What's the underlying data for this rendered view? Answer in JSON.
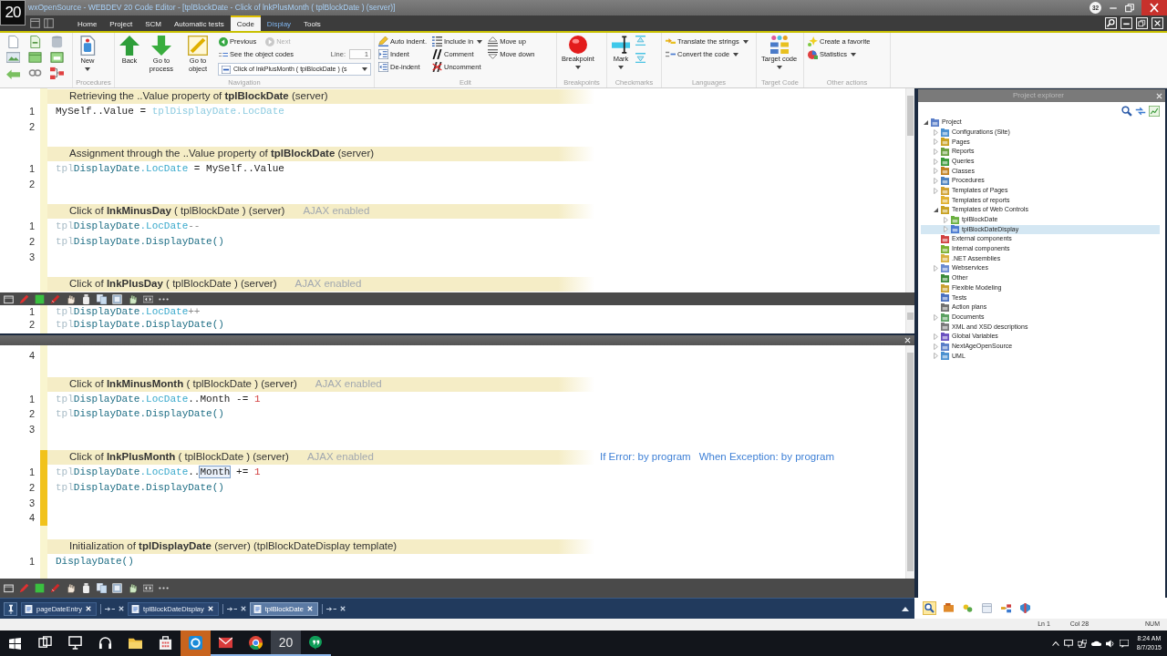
{
  "title_bar": {
    "logo": "20",
    "title": "wxOpenSource - WEBDEV 20  Code Editor - [tplBlockDate - Click of lnkPlusMonth ( tplBlockDate ) (server)]",
    "badge": "32"
  },
  "menu_tabs": [
    {
      "label": "Home",
      "selected": false,
      "kind": "standard"
    },
    {
      "label": "Project",
      "selected": false,
      "kind": "standard"
    },
    {
      "label": "SCM",
      "selected": false,
      "kind": "standard"
    },
    {
      "label": "Automatic tests",
      "selected": false,
      "kind": "standard"
    },
    {
      "label": "Code",
      "selected": true,
      "kind": "standard"
    },
    {
      "label": "Display",
      "selected": false,
      "kind": "contextual"
    },
    {
      "label": "Tools",
      "selected": false,
      "kind": "standard"
    }
  ],
  "ribbon": {
    "procedures": {
      "label": "Procedures",
      "new_button": "New"
    },
    "navigation": {
      "label": "Navigation",
      "back": "Back",
      "go_to_process": "Go to process",
      "go_to_object": "Go to object",
      "previous": {
        "label": "Previous",
        "disabled": false
      },
      "next": {
        "label": "Next",
        "disabled": true
      },
      "object_codes": "See the object codes",
      "line_label": "Line:",
      "line_value": "1",
      "event": "Click of lnkPlusMonth ( tplBlockDate ) (s"
    },
    "edit": {
      "label": "Edit",
      "columns": [
        [
          {
            "label": "Auto indent.",
            "kind": "auto-indent",
            "dropdown": false
          },
          {
            "label": "Indent",
            "kind": "indent",
            "dropdown": false
          },
          {
            "label": "De-indent",
            "kind": "de-indent",
            "dropdown": false
          }
        ],
        [
          {
            "label": "Include in",
            "kind": "include",
            "dropdown": true
          },
          {
            "label": "Comment",
            "kind": "comment",
            "dropdown": false
          },
          {
            "label": "Uncomment",
            "kind": "uncomment",
            "dropdown": false
          }
        ],
        [
          {
            "label": "Move up",
            "kind": "move-up",
            "dropdown": false
          },
          {
            "label": "Move down",
            "kind": "move-down",
            "dropdown": false
          }
        ]
      ]
    },
    "breakpoints": {
      "label": "Breakpoints",
      "button": "Breakpoint"
    },
    "checkmarks": {
      "label": "Checkmarks",
      "button": "Mark"
    },
    "languages": {
      "label": "Languages",
      "items": [
        {
          "label": "Translate the strings",
          "kind": "translate",
          "dropdown": true
        },
        {
          "label": "Convert the code",
          "kind": "convert",
          "dropdown": true
        }
      ]
    },
    "target_code": {
      "label": "Target Code",
      "button": "Target code"
    },
    "other_actions": {
      "label": "Other actions",
      "items": [
        {
          "label": "Create a favorite",
          "kind": "favorite",
          "dropdown": false
        },
        {
          "label": "Statistics",
          "kind": "statistics",
          "dropdown": true
        }
      ]
    }
  },
  "editor": {
    "upper_pane": {
      "blocks": [
        {
          "title": "Retrieving the ..Value property of **tplBlockDate** (server)",
          "current": false,
          "lines": [
            {
              "number": "1",
              "code": [
                {
                  "text": "MySelf..Value = ",
                  "kind": "plain"
                },
                {
                  "text": "tplDisplayDate.LocDate",
                  "kind": "faded"
                }
              ]
            },
            {
              "number": "2"
            }
          ]
        },
        {
          "title": "Assignment through the ..Value property of **tplBlockDate** (server)",
          "current": false,
          "lines": [
            {
              "number": "1",
              "code": [
                {
                  "text": "tpl",
                  "kind": "prefix"
                },
                {
                  "text": "DisplayDate",
                  "kind": "object"
                },
                {
                  "text": ".LocDate",
                  "kind": "property"
                },
                {
                  "text": " = MySelf..Value",
                  "kind": "plain"
                }
              ]
            },
            {
              "number": "2"
            }
          ]
        },
        {
          "title": "Click of **lnkMinusDay** ( tplBlockDate ) (server)",
          "ajax": "AJAX enabled",
          "current": false,
          "lines": [
            {
              "number": "1",
              "code": [
                {
                  "text": "tpl",
                  "kind": "prefix"
                },
                {
                  "text": "DisplayDate",
                  "kind": "object"
                },
                {
                  "text": ".LocDate",
                  "kind": "property"
                },
                {
                  "text": "--",
                  "kind": "operator"
                }
              ]
            },
            {
              "number": "2",
              "code": [
                {
                  "text": "tpl",
                  "kind": "prefix"
                },
                {
                  "text": "DisplayDate.DisplayDate()",
                  "kind": "object"
                }
              ]
            },
            {
              "number": "3"
            }
          ]
        },
        {
          "title": "Click of **lnkPlusDay** ( tplBlockDate ) (server)",
          "ajax": "AJAX enabled",
          "current": false
        }
      ]
    },
    "split_pane": {
      "lines": [
        {
          "number": "1",
          "code": [
            {
              "text": "tpl",
              "kind": "prefix"
            },
            {
              "text": "DisplayDate",
              "kind": "object"
            },
            {
              "text": ".LocDate",
              "kind": "property"
            },
            {
              "text": "++",
              "kind": "operator"
            }
          ]
        },
        {
          "number": "2",
          "code": [
            {
              "text": "tpl",
              "kind": "prefix"
            },
            {
              "text": "DisplayDate.DisplayDate()",
              "kind": "object"
            }
          ]
        }
      ]
    },
    "lower_pane": {
      "lines": [
        {
          "number": "4"
        }
      ],
      "blocks": [
        {
          "title": "Click of **lnkMinusMonth** ( tplBlockDate ) (server)",
          "ajax": "AJAX enabled",
          "current": false,
          "lines": [
            {
              "number": "1",
              "code": [
                {
                  "text": "tpl",
                  "kind": "prefix"
                },
                {
                  "text": "DisplayDate",
                  "kind": "object"
                },
                {
                  "text": ".LocDate",
                  "kind": "property"
                },
                {
                  "text": "..Month -= ",
                  "kind": "plain"
                },
                {
                  "text": "1",
                  "kind": "number"
                }
              ]
            },
            {
              "number": "2",
              "code": [
                {
                  "text": "tpl",
                  "kind": "prefix"
                },
                {
                  "text": "DisplayDate.DisplayDate()",
                  "kind": "object"
                }
              ]
            },
            {
              "number": "3"
            }
          ]
        },
        {
          "title": "Click of **lnkPlusMonth** ( tplBlockDate ) (server)",
          "ajax": "AJAX enabled",
          "error_handling": [
            "If Error: by program",
            "When Exception: by program"
          ],
          "current": true,
          "lines": [
            {
              "number": "1",
              "code": [
                {
                  "text": "tpl",
                  "kind": "prefix"
                },
                {
                  "text": "DisplayDate",
                  "kind": "object"
                },
                {
                  "text": ".LocDate",
                  "kind": "property"
                },
                {
                  "text": "..",
                  "kind": "plain"
                },
                {
                  "text": "Month",
                  "kind": "selection"
                },
                {
                  "text": " += ",
                  "kind": "plain"
                },
                {
                  "text": "1",
                  "kind": "number"
                }
              ]
            },
            {
              "number": "2",
              "code": [
                {
                  "text": "tpl",
                  "kind": "prefix"
                },
                {
                  "text": "DisplayDate.DisplayDate()",
                  "kind": "object"
                }
              ]
            },
            {
              "number": "3"
            },
            {
              "number": "4"
            }
          ]
        },
        {
          "title": "Initialization of **tplDisplayDate** (server) (tplBlockDateDisplay template)",
          "current": false,
          "lines": [
            {
              "number": "1",
              "code": [
                {
                  "text": "DisplayDate()",
                  "kind": "object"
                }
              ]
            }
          ]
        }
      ]
    }
  },
  "explorer": {
    "title": "Project explorer",
    "tree": [
      {
        "label": "Project",
        "expandable": true,
        "expanded": true,
        "selected": false,
        "children": [
          {
            "label": "Configurations (Site)",
            "expandable": true,
            "expanded": false,
            "selected": false
          },
          {
            "label": "Pages",
            "expandable": true,
            "expanded": false,
            "selected": false
          },
          {
            "label": "Reports",
            "expandable": true,
            "expanded": false,
            "selected": false
          },
          {
            "label": "Queries",
            "expandable": true,
            "expanded": false,
            "selected": false
          },
          {
            "label": "Classes",
            "expandable": true,
            "expanded": false,
            "selected": false
          },
          {
            "label": "Procedures",
            "expandable": true,
            "expanded": false,
            "selected": false
          },
          {
            "label": "Templates of Pages",
            "expandable": true,
            "expanded": false,
            "selected": false
          },
          {
            "label": "Templates of reports",
            "expandable": false,
            "selected": false
          },
          {
            "label": "Templates of Web Controls",
            "expandable": true,
            "expanded": true,
            "selected": false,
            "children": [
              {
                "label": "tplBlockDate",
                "expandable": true,
                "expanded": false,
                "selected": false
              },
              {
                "label": "tplBlockDateDisplay",
                "expandable": true,
                "expanded": false,
                "selected": true
              }
            ]
          },
          {
            "label": "External components",
            "expandable": false,
            "selected": false
          },
          {
            "label": "Internal components",
            "expandable": false,
            "selected": false
          },
          {
            "label": ".NET Assemblies",
            "expandable": false,
            "selected": false
          },
          {
            "label": "Webservices",
            "expandable": true,
            "expanded": false,
            "selected": false
          },
          {
            "label": "Other",
            "expandable": false,
            "selected": false
          },
          {
            "label": "Flexible Modeling",
            "expandable": false,
            "selected": false
          },
          {
            "label": "Tests",
            "expandable": false,
            "selected": false
          },
          {
            "label": "Action plans",
            "expandable": false,
            "selected": false
          },
          {
            "label": "Documents",
            "expandable": true,
            "expanded": false,
            "selected": false
          },
          {
            "label": "XML and XSD descriptions",
            "expandable": false,
            "selected": false
          },
          {
            "label": "Global Variables",
            "expandable": true,
            "expanded": false,
            "selected": false
          },
          {
            "label": "NextAgeOpenSource",
            "expandable": true,
            "expanded": false,
            "selected": false
          },
          {
            "label": "UML",
            "expandable": true,
            "expanded": false,
            "selected": false
          }
        ]
      }
    ]
  },
  "panel_switcher": [
    {
      "selected": true
    },
    {
      "selected": false
    },
    {
      "selected": false
    },
    {
      "selected": false
    },
    {
      "selected": false
    },
    {
      "selected": false
    }
  ],
  "doc_tabs": {
    "tabs": [
      {
        "label": "pageDateEntry",
        "selected": false
      },
      {
        "label": "tplBlockDateDisplay",
        "selected": false
      },
      {
        "label": "tplBlockDate",
        "selected": true
      }
    ]
  },
  "status_bar": {
    "line": "Ln 1",
    "column": "Col 28",
    "keyboard": "NUM"
  },
  "taskbar": {
    "apps": [
      {
        "kind": "task-view",
        "running": false,
        "active": false,
        "flashing": false
      },
      {
        "kind": "monitor",
        "running": false,
        "active": false,
        "flashing": false
      },
      {
        "kind": "headset",
        "running": false,
        "active": false,
        "flashing": false
      },
      {
        "kind": "folder",
        "running": false,
        "active": false,
        "flashing": false
      },
      {
        "kind": "store",
        "running": false,
        "active": false,
        "flashing": false
      },
      {
        "kind": "chat",
        "running": false,
        "active": false,
        "flashing": true
      },
      {
        "kind": "mail",
        "running": true,
        "active": false,
        "flashing": false
      },
      {
        "kind": "round",
        "running": true,
        "active": false,
        "flashing": false
      },
      {
        "kind": "tile",
        "label": "20",
        "running": true,
        "active": true,
        "flashing": false
      },
      {
        "kind": "bubble",
        "running": true,
        "active": false,
        "flashing": false
      }
    ],
    "time": "8:24 AM",
    "date": "8/7/2015"
  }
}
